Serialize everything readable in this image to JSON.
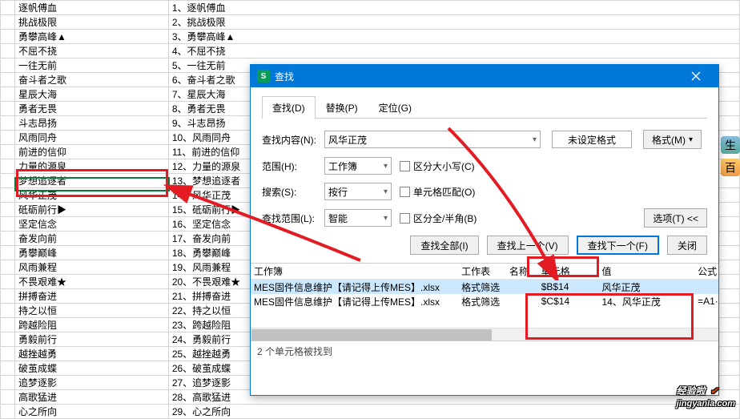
{
  "columns": {
    "b": [
      "逐帆傅血",
      "挑战极限",
      "勇攀高峰▲",
      "不屈不挠",
      "一往无前",
      "奋斗者之歌",
      "星辰大海",
      "勇者无畏",
      "斗志昂扬",
      "风雨同舟",
      "前进的信仰",
      "力量的源泉",
      "梦想追逐者",
      "风华正茂",
      "砥砺前行▶",
      "坚定信念",
      "奋发向前",
      "勇攀巅峰",
      "风雨兼程",
      "不畏艰难★",
      "拼搏奋进",
      "持之以恒",
      "跨越险阻",
      "勇毅前行",
      "越挫越勇",
      "破茧成蝶",
      "追梦逐影",
      "高歌猛进",
      "心之所向"
    ],
    "c": [
      "1、逐帆傅血",
      "2、挑战极限",
      "3、勇攀高峰▲",
      "4、不屈不挠",
      "5、一往无前",
      "6、奋斗者之歌",
      "7、星辰大海",
      "8、勇者无畏",
      "9、斗志昂扬",
      "10、风雨同舟",
      "11、前进的信仰",
      "12、力量的源泉",
      "13、梦想追逐者",
      "14、风华正茂",
      "15、砥砺前行▶",
      "16、坚定信念",
      "17、奋发向前",
      "18、勇攀巅峰",
      "19、风雨兼程",
      "20、不畏艰难★",
      "21、拼搏奋进",
      "22、持之以恒",
      "23、跨越险阻",
      "24、勇毅前行",
      "25、越挫越勇",
      "26、破茧成蝶",
      "27、追梦逐影",
      "28、高歌猛进",
      "29、心之所向"
    ]
  },
  "dialog": {
    "title": "查找",
    "tabs": {
      "find": "查找(D)",
      "replace": "替换(P)",
      "goto": "定位(G)"
    },
    "content_label": "查找内容(N):",
    "content_value": "风华正茂",
    "fmt_unset": "未设定格式",
    "fmt_btn": "格式(M)",
    "range_label": "范围(H):",
    "range_value": "工作簿",
    "case_chk": "区分大小写(C)",
    "search_label": "搜索(S):",
    "search_value": "按行",
    "match_chk": "单元格匹配(O)",
    "scope_label": "查找范围(L):",
    "scope_value": "智能",
    "width_chk": "区分全/半角(B)",
    "options_btn": "选项(T) <<",
    "btn_all": "查找全部(I)",
    "btn_prev": "查找上一个(V)",
    "btn_next": "查找下一个(F)",
    "btn_close": "关闭",
    "cols": {
      "wb": "工作簿",
      "ws": "工作表",
      "nm": "名称",
      "cell": "单元格",
      "val": "值",
      "fm": "公式"
    },
    "rows": [
      {
        "wb": "MES固件信息维护【请记得上传MES】.xlsx",
        "ws": "格式筛选",
        "nm": "",
        "cell": "$B$14",
        "val": "风华正茂",
        "fm": ""
      },
      {
        "wb": "MES固件信息维护【请记得上传MES】.xlsx",
        "ws": "格式筛选",
        "nm": "",
        "cell": "$C$14",
        "val": "14、风华正茂",
        "fm": "=A1·"
      }
    ],
    "status": "2 个单元格被找到"
  },
  "watermark": {
    "big": "经验啦",
    "small": "jingyanla.com"
  },
  "side": {
    "a": "生",
    "b": "百"
  }
}
